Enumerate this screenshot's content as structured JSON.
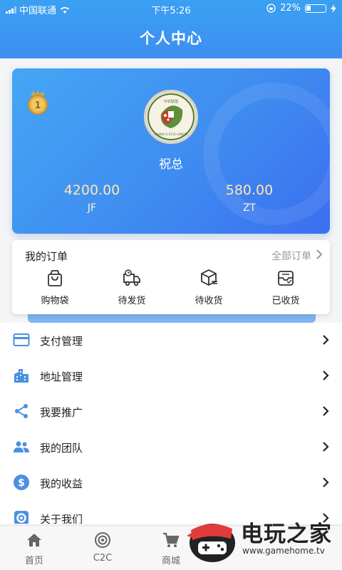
{
  "status_bar": {
    "carrier": "中国联通",
    "time": "下午5:26",
    "battery": "22%"
  },
  "header": {
    "title": "个人中心"
  },
  "profile": {
    "rank": "1",
    "logo_text": "CHINA'S ECO-UNION",
    "logo_top_text": "中农联盟",
    "name": "祝总",
    "stats": [
      {
        "value": "4200.00",
        "label": "JF"
      },
      {
        "value": "580.00",
        "label": "ZT"
      }
    ]
  },
  "orders": {
    "title": "我的订单",
    "all_label": "全部订单",
    "items": [
      {
        "label": "购物袋",
        "icon": "shopping-bag-icon"
      },
      {
        "label": "待发货",
        "icon": "delivery-truck-icon"
      },
      {
        "label": "待收货",
        "icon": "package-box-icon"
      },
      {
        "label": "已收货",
        "icon": "received-tray-icon"
      }
    ]
  },
  "menu": [
    {
      "label": "支付管理",
      "icon": "credit-card-icon"
    },
    {
      "label": "地址管理",
      "icon": "building-icon"
    },
    {
      "label": "我要推广",
      "icon": "share-icon"
    },
    {
      "label": "我的团队",
      "icon": "team-icon"
    },
    {
      "label": "我的收益",
      "icon": "dollar-icon"
    },
    {
      "label": "关于我们",
      "icon": "gear-icon"
    }
  ],
  "tabbar": [
    {
      "label": "首页",
      "icon": "home-icon"
    },
    {
      "label": "C2C",
      "icon": "c2c-icon"
    },
    {
      "label": "商城",
      "icon": "cart-icon"
    }
  ],
  "watermark": {
    "title": "电玩之家",
    "url": "www.gamehome.tv"
  },
  "colors": {
    "accent": "#3d8ff0",
    "icon_blue": "#4a90e2",
    "gold": "#ffe7b0"
  }
}
